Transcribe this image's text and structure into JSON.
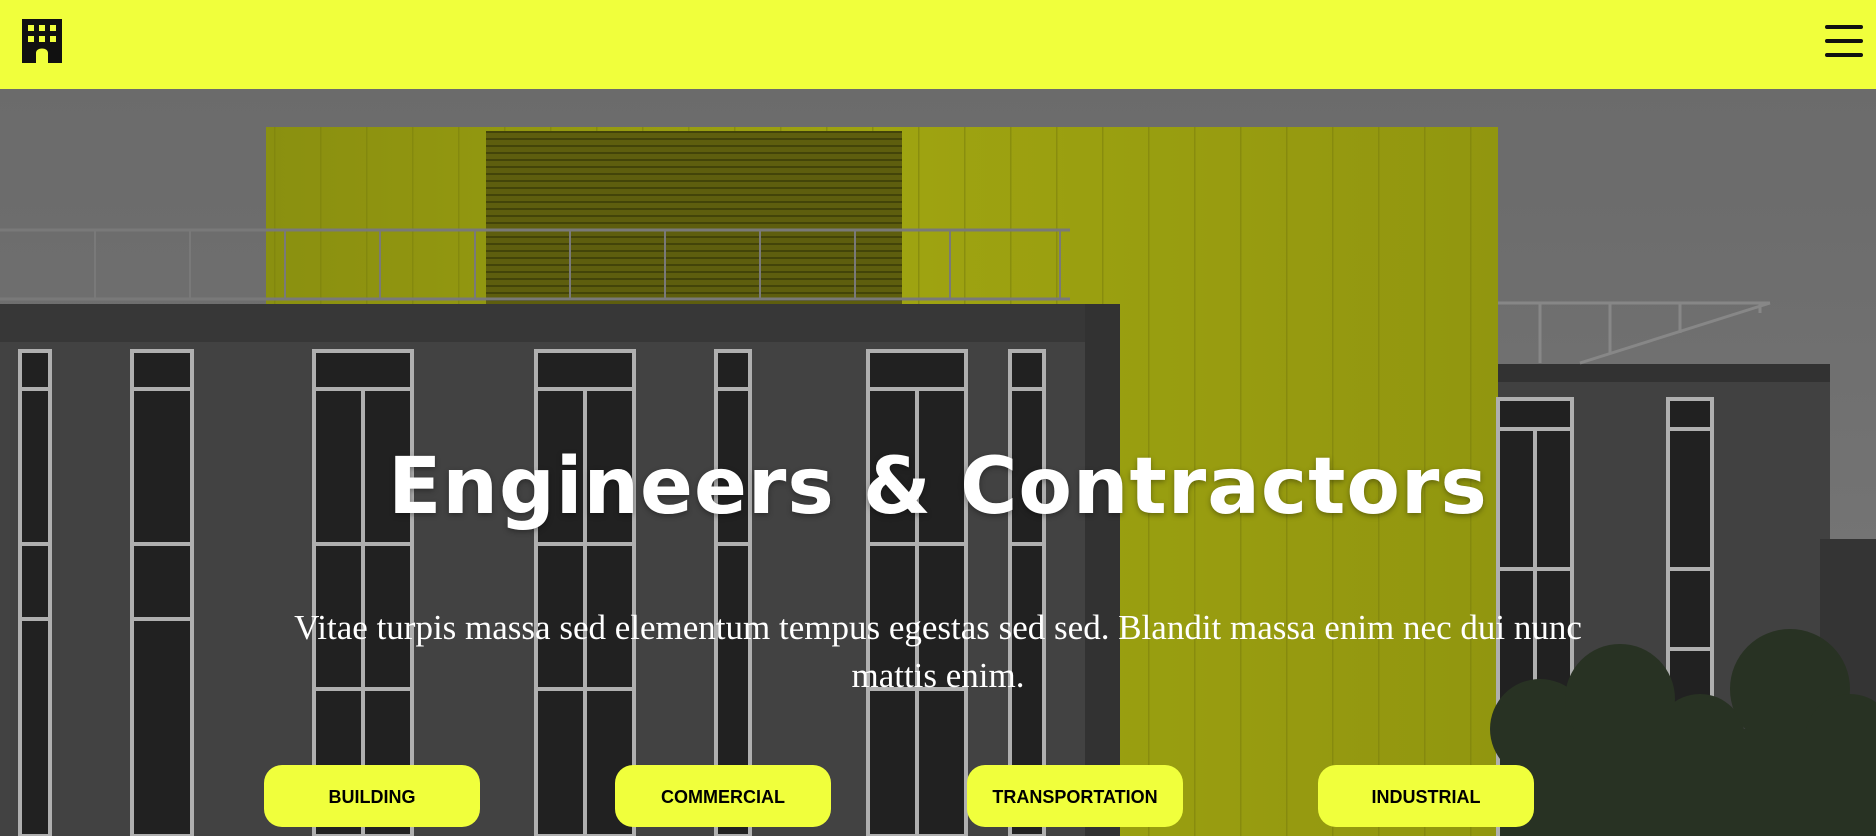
{
  "header": {
    "logo_icon": "building-icon",
    "menu_icon": "hamburger-menu-icon",
    "background": "#f0ff3c"
  },
  "hero": {
    "title": "Engineers & Contractors",
    "subtitle": "Vitae turpis massa sed elementum tempus egestas sed sed. Blandit massa enim nec dui nunc mattis enim.",
    "background_image": "building-facade-photo"
  },
  "categories": [
    {
      "label": "BUILDING"
    },
    {
      "label": "COMMERCIAL"
    },
    {
      "label": "TRANSPORTATION"
    },
    {
      "label": "INDUSTRIAL"
    }
  ],
  "colors": {
    "accent": "#f0ff3c",
    "text_dark": "#000000",
    "text_light": "#ffffff"
  }
}
